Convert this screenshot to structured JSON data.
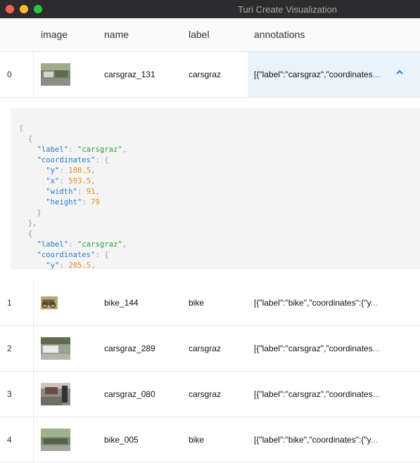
{
  "window": {
    "title": "Turi Create Visualization"
  },
  "columns": {
    "image": "image",
    "name": "name",
    "label": "label",
    "annotations": "annotations"
  },
  "rows": [
    {
      "index": "0",
      "name": "carsgraz_131",
      "label": "carsgraz",
      "annotations": "[{\"label\":\"carsgraz\",\"coordinates",
      "ellipsis": "...",
      "expanded": true
    },
    {
      "index": "1",
      "name": "bike_144",
      "label": "bike",
      "annotations": "[{\"label\":\"bike\",\"coordinates\":{\"y",
      "ellipsis": "...",
      "expanded": false
    },
    {
      "index": "2",
      "name": "carsgraz_289",
      "label": "carsgraz",
      "annotations": "[{\"label\":\"carsgraz\",\"coordinates",
      "ellipsis": "...",
      "expanded": false
    },
    {
      "index": "3",
      "name": "carsgraz_080",
      "label": "carsgraz",
      "annotations": "[{\"label\":\"carsgraz\",\"coordinates",
      "ellipsis": "...",
      "expanded": false
    },
    {
      "index": "4",
      "name": "bike_005",
      "label": "bike",
      "annotations": "[{\"label\":\"bike\",\"coordinates\":{\"y",
      "ellipsis": "...",
      "expanded": false
    }
  ],
  "json_view": {
    "lines": [
      [
        [
          "p",
          "["
        ]
      ],
      [
        [
          "p",
          "  {"
        ]
      ],
      [
        [
          "p",
          "    "
        ],
        [
          "k",
          "\"label\""
        ],
        [
          "p",
          ": "
        ],
        [
          "s",
          "\"carsgraz\""
        ],
        [
          "p",
          ","
        ]
      ],
      [
        [
          "p",
          "    "
        ],
        [
          "k",
          "\"coordinates\""
        ],
        [
          "p",
          ": {"
        ]
      ],
      [
        [
          "p",
          "      "
        ],
        [
          "k",
          "\"y\""
        ],
        [
          "p",
          ": "
        ],
        [
          "n",
          "180.5"
        ],
        [
          "p",
          ","
        ]
      ],
      [
        [
          "p",
          "      "
        ],
        [
          "k",
          "\"x\""
        ],
        [
          "p",
          ": "
        ],
        [
          "n",
          "593.5"
        ],
        [
          "p",
          ","
        ]
      ],
      [
        [
          "p",
          "      "
        ],
        [
          "k",
          "\"width\""
        ],
        [
          "p",
          ": "
        ],
        [
          "n",
          "91"
        ],
        [
          "p",
          ","
        ]
      ],
      [
        [
          "p",
          "      "
        ],
        [
          "k",
          "\"height\""
        ],
        [
          "p",
          ": "
        ],
        [
          "n",
          "79"
        ]
      ],
      [
        [
          "p",
          "    }"
        ]
      ],
      [
        [
          "p",
          "  },"
        ]
      ],
      [
        [
          "p",
          "  {"
        ]
      ],
      [
        [
          "p",
          "    "
        ],
        [
          "k",
          "\"label\""
        ],
        [
          "p",
          ": "
        ],
        [
          "s",
          "\"carsgraz\""
        ],
        [
          "p",
          ","
        ]
      ],
      [
        [
          "p",
          "    "
        ],
        [
          "k",
          "\"coordinates\""
        ],
        [
          "p",
          ": {"
        ]
      ],
      [
        [
          "p",
          "      "
        ],
        [
          "k",
          "\"y\""
        ],
        [
          "p",
          ": "
        ],
        [
          "n",
          "205.5"
        ],
        [
          "p",
          ","
        ]
      ]
    ]
  },
  "colors": {
    "accent": "#2a7ad2",
    "string": "#2aa33c",
    "number": "#e88f0f",
    "selected_bg": "#e8f3fc"
  }
}
